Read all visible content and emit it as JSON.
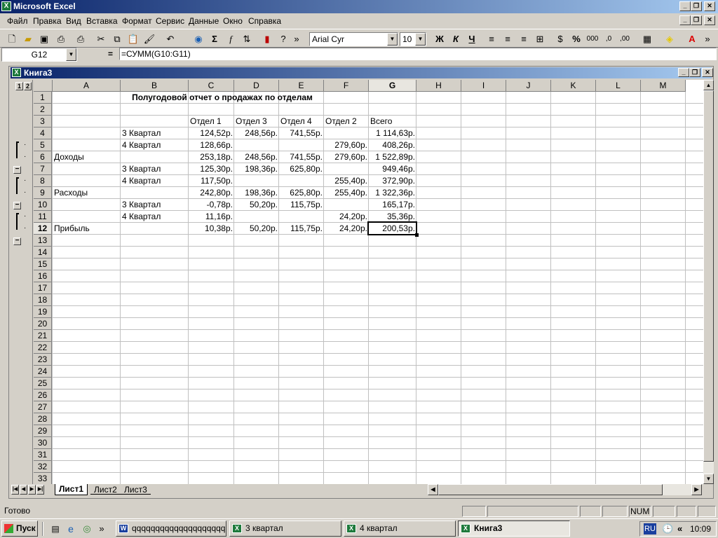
{
  "app": {
    "title": "Microsoft Excel",
    "icon": "excel-icon",
    "controls": {
      "minimize": "_",
      "restore": "❐",
      "close": "✕"
    }
  },
  "menu": [
    "Файл",
    "Правка",
    "Вид",
    "Вставка",
    "Формат",
    "Сервис",
    "Данные",
    "Окно",
    "Справка"
  ],
  "toolbar": {
    "font_name": "Arial Cyr",
    "font_size": "10",
    "bold": "Ж",
    "italic": "К",
    "underline": "Ч",
    "sum_symbol": "Σ",
    "fx_symbol": "f",
    "percent": "%",
    "thousands": "000",
    "dec_inc": ",0",
    "dec_dec": ",00"
  },
  "formula_bar": {
    "name_box": "G12",
    "equals": "=",
    "formula": "=СУММ(G10:G11)"
  },
  "workbook": {
    "title": "Книга3"
  },
  "outline_levels": [
    "1",
    "2"
  ],
  "columns": [
    "A",
    "B",
    "C",
    "D",
    "E",
    "F",
    "G",
    "H",
    "I",
    "J",
    "K",
    "L",
    "M"
  ],
  "rows": [
    "1",
    "2",
    "3",
    "4",
    "5",
    "6",
    "7",
    "8",
    "9",
    "10",
    "11",
    "12",
    "13",
    "14",
    "15",
    "16",
    "17",
    "18",
    "19",
    "20",
    "21",
    "22",
    "23",
    "24",
    "25",
    "26",
    "27",
    "28",
    "29",
    "30",
    "31",
    "32",
    "33"
  ],
  "cells": {
    "title": "Полугодовой отчет о продажах по отделам",
    "headers": [
      "Отдел 1",
      "Отдел 3",
      "Отдел 4",
      "Отдел 2",
      "Всего"
    ],
    "r4": {
      "b": "3 Квартал",
      "c": "124,52р.",
      "d": "248,56р.",
      "e": "741,55р.",
      "f": "",
      "g": "1 114,63р."
    },
    "r5": {
      "b": "4 Квартал",
      "c": "128,66р.",
      "d": "",
      "e": "",
      "f": "279,60р.",
      "g": "408,26р."
    },
    "r6": {
      "a": "Доходы",
      "c": "253,18р.",
      "d": "248,56р.",
      "e": "741,55р.",
      "f": "279,60р.",
      "g": "1 522,89р."
    },
    "r7": {
      "b": "3 Квартал",
      "c": "125,30р.",
      "d": "198,36р.",
      "e": "625,80р.",
      "f": "",
      "g": "949,46р."
    },
    "r8": {
      "b": "4 Квартал",
      "c": "117,50р.",
      "d": "",
      "e": "",
      "f": "255,40р.",
      "g": "372,90р."
    },
    "r9": {
      "a": "Расходы",
      "c": "242,80р.",
      "d": "198,36р.",
      "e": "625,80р.",
      "f": "255,40р.",
      "g": "1 322,36р."
    },
    "r10": {
      "b": "3 Квартал",
      "c": "-0,78р.",
      "d": "50,20р.",
      "e": "115,75р.",
      "f": "",
      "g": "165,17р."
    },
    "r11": {
      "b": "4 Квартал",
      "c": "11,16р.",
      "d": "",
      "e": "",
      "f": "24,20р.",
      "g": "35,36р."
    },
    "r12": {
      "a": "Прибыль",
      "c": "10,38р.",
      "d": "50,20р.",
      "e": "115,75р.",
      "f": "24,20р.",
      "g": "200,53р."
    }
  },
  "sheets": [
    "Лист1",
    "Лист2",
    "Лист3"
  ],
  "status": {
    "ready": "Готово",
    "num": "NUM"
  },
  "taskbar": {
    "start": "Пуск",
    "tasks": [
      "qqqqqqqqqqqqqqqqqqqqq...",
      "3 квартал",
      "4 квартал",
      "Книга3"
    ],
    "lang": "RU",
    "chevron": "«",
    "more": "»",
    "time": "10:09"
  }
}
